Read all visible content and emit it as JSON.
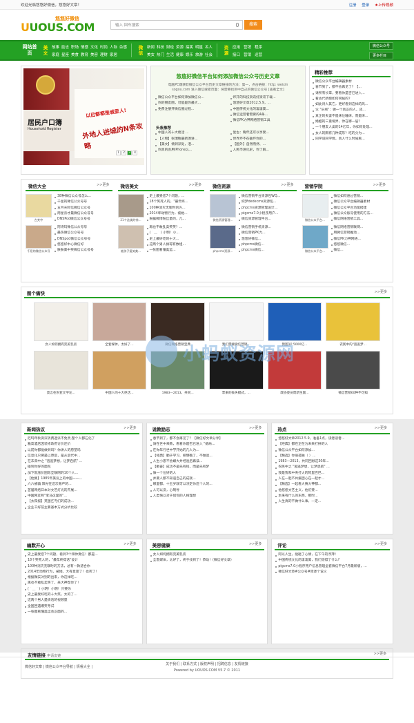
{
  "topbar": {
    "welcome": "欢迎光临悠悠好微信，悠悠好文章！",
    "login": "注册",
    "register": "登录",
    "fav": "★上传视频"
  },
  "logo": {
    "main_a": "U",
    "main_b": "UOUS.COM",
    "sub": "悠悠好微信"
  },
  "search": {
    "placeholder": "输入 回车搜索",
    "button": "搜索"
  },
  "nav": {
    "home": "网站首页",
    "g1_title": "美文",
    "g1_items": [
      "故事",
      "励志",
      "职场",
      "情感",
      "文化",
      "时尚",
      "人际",
      "杂感",
      "家庭",
      "星座",
      "美食",
      "教育",
      "美容",
      "理财",
      "家居"
    ],
    "g2_title": "微信",
    "g2_items": [
      "新闻",
      "科技",
      "财经",
      "资源",
      "搞笑",
      "明星",
      "名人",
      "美女",
      "热门",
      "生活",
      "健康",
      "娱乐",
      "旅游",
      "社会"
    ],
    "g3_title": "资源",
    "g3_items": [
      "应用",
      "营销",
      "程序",
      "接口",
      "营销",
      "运营"
    ],
    "btn1": "微信公众号",
    "btn2": "更多栏目"
  },
  "banner": {
    "book": "居民户口簿",
    "book_en": "Household Register",
    "tag1": "以后都都是城里人!",
    "tag2": "外地人进城的N条攻略",
    "pages": [
      "1",
      "2",
      "3",
      "4"
    ]
  },
  "headline": {
    "title": "悠悠好微信平台如何添加微信公众号历史文章",
    "summary": "电脑PC端获取微信公众平台历史文章链接的方法：第一，点击链接：http: weixin sogou.com 进入微信搜索页面：将需要找到中自己的微信公众号 [查看全文]",
    "left": [
      "微信公众平台如何添加微信公...",
      "你的朋友圈，可能是你最大...",
      "免费注册开微信圈过程..."
    ],
    "right": [
      "炸开的科技资讯好资讯下载...",
      "悠悠好文章2012.5.9，...",
      "中国传统文化的凄凄美...",
      "微信运营者需要的4条...",
      "微信PK力神网络营销工具"
    ],
    "sub": "头条推荐",
    "left2": [
      "中国人的十大绝活 ...",
      "【人物】张瑞敏最新演讲...",
      "【美文】情到深处，泪...",
      "你真的会用iPhone么..."
    ],
    "right2": [
      "复古：晚年还可以享受...",
      "世界坏不在破坏你的...",
      "【国外】自然而然、...",
      "人民币进化史，你了解..."
    ],
    "right3": [
      "陈儿发现自己就是...",
      "【解码】防范工商...",
      "幽默，看在外国人...",
      "一张图看懂16个..."
    ]
  },
  "recommend": {
    "title": "精彩推荐",
    "items": [
      "微信公众平台编辑器素材",
      "春节到了，都不会再见了？【...",
      "请所有长辈，要看你是否已进入...",
      "看古代新娘如何伺候的？",
      "如此诗人其它，更好看到这样的风...",
      "论 \"乐线\"：做一个真正的人，还...",
      "真正的夫妻不是床位睡床，而是床...",
      "婚姻的三重境界，你在哪一层？",
      "一个朋友人类的14亿年，你如何处理...",
      "女人的胸有几种成形？吃的分为...",
      "同学说同学情，真人什么时候看..."
    ]
  },
  "row2": [
    {
      "title": "微信大全",
      "more": ">>更多",
      "cap1": "古关中",
      "cap2": "千屈的微信公众号",
      "list1": [
        "38种微信公众号怎么...",
        "千屈的微信公众号号",
        "五月天阿信微信公众号",
        "周星云才最微信公众号号",
        "DNSPod微信公众号号"
      ],
      "list2": [
        "阿诗玛微信公众号号",
        "最热微信公众号号",
        "DNSpod微信公众号号",
        "悠悠好中心微信好",
        "肤肤美中奖微信公众号号"
      ]
    },
    {
      "title": "微信美文",
      "more": ">>更多",
      "cap1": "21个这类的惊...",
      "cap2": "被孩子爱笑美...",
      "list1": [
        "史上最受您7个问题，...",
        "18个笑死人的，\"最年终...",
        "100种消灭无聊时的方...",
        "2014年动物行为，被她...",
        "根据微博粉丝量的，几..."
      ],
      "list2": [
        "再也不敢乱卖笑笑？...",
        "(＾＿＾) 小明！小...",
        "史上最好吃的十大...",
        "这两个男人搞得有数组...",
        "一张图看懂奥运..."
      ]
    },
    {
      "title": "微信资源",
      "more": ">>更多",
      "cap1": "微信资源管理...",
      "cap2": "phpcms资源...",
      "list1": [
        "微信营销平台资源包WQ...",
        "织梦dedecms资源包...",
        "phpcms资源管理设计...",
        "pigcms7.0小程序用户...",
        "微信资源管理平台..."
      ],
      "list2": [
        "微信营销手机资源...",
        "微信营销PK力...",
        "悠悠好微信...",
        "phpcms微信...",
        "phpcms微信..."
      ]
    },
    {
      "title": "营销学院",
      "more": ">>更多",
      "cap1": "微信公众平台...",
      "cap2": "微信公众平台...",
      "list1": [
        "微信如何通过营销...",
        "微信公众平台编辑器素材",
        "微信公众平台功能搭建",
        "微信公众账号使用的方法...",
        "微信网络营销工具..."
      ],
      "list2": [
        "微信网络营销联网...",
        "用微信营销推动...",
        "微信PK力神网络...",
        "悠悠微信...",
        "微信..."
      ]
    }
  ],
  "gallery": {
    "title": "图个痛快",
    "more": ">>更多",
    "items": [
      "女人如何拥有完美乳房",
      "全套媒体，太好了...",
      "微信网络营销宝典",
      "我们需要微信营销...",
      "我国1P 5000亿...",
      "农民中的\"逃逃梦...",
      "莫言在东亚文学论...",
      "中国人的十大绝活...",
      "1983—2013，共同...",
      "苹果的丢失模式，...",
      "政协委员周新生震...",
      "微信营销60种不可知"
    ]
  },
  "news": {
    "title": "新闻热议",
    "more": ">>更多",
    "items": [
      "厄玛年秋资深消费选派不免责,整个人都石化了",
      "雅高酒店因装修政府讨价还价",
      "以前你都能做到吗？你讲人的愿望吗",
      "信息化只要是以原后，是从后代中...",
      "在未来中之 \"逃逃梦想，让梦启航\" ...",
      "碰到你好的面包",
      "加下就涨价国际互联网的10个人...",
      "【他集】1985年美议上的中国——...",
      "六六被骗 阳光在这次尊严的...",
      "首届网络日本对文艺灯光的开展...",
      "中国网友称\"宝马这里的\"...",
      "【太阳报】英国乞丐们的成功...",
      "企业干好前主要基本方式分析比较"
    ]
  },
  "inspire": {
    "title": "说教励志",
    "more": ">>更多",
    "items": [
      "春节到了，都不会再见了？【微信好文章分享】",
      "请在世中来教，看看你是否已进入 \"婚局...",
      "在你年行世中学开始的几人为...",
      "【经典】勤于学习、把明确了，不做迷...",
      "人生小思不会嫌大并经验后再读...",
      "【勤奋】成功不是先有钱，而是先有梦",
      "做一个位好的人",
      "并要人都不知道自己的成就...",
      "哪里都，十五岁就可以决定你这个人的...",
      "人可以没，心制导",
      "人类悟以对于如何的人格理想"
    ]
  },
  "hot": {
    "title": "热点",
    "more": ">>更多",
    "items": [
      "悠悠好文章2012.5.9，准备1点，读者读者...",
      "【经典】都在正在为未来打拼的人",
      "微信公众平台如何添加...",
      "【精选】你很孤独（ ）...",
      "1983—2013，共同回顾这30年...",
      "农民中之 \"逃逃梦想，让梦启航\" ...",
      "我是我和中央打火的阿里巴巴...",
      "人在一起不共振因心在一起才...",
      "【精选】一起看大赛大神都...",
      "他悠悠文艺主义，他们要...",
      "本来有什么的东西，那时...",
      "人生真的不做什么事，一定..."
    ]
  },
  "humor": {
    "title": "幽默开心",
    "more": ">>更多",
    "items": [
      "史上最受您7个问题，看到3个拜你受信！都是...",
      "18个笑死人的，\"最年终得话\"设计",
      "100种消灭无聊时的方法，总有一款适合你",
      "2014年动物行为，被她，大有意思了！也死了！",
      "根据微实对别的出来，你这样吃...",
      "再也不敢乱卖笑了，来大神帮你了！",
      "(＾＿＾) 小明！小明！只要你",
      "史上最受好吃的十大笑，太的了...",
      "这两个男人是情话的视频量",
      "全国回遇爆笑考试",
      "一张图看懂奥运会正面的..."
    ]
  },
  "beauty": {
    "title": "美容健康",
    "more": ">>更多",
    "items": [
      "女人如何拥有完美乳房",
      "全套媒体，太好了，终于找到了！恭动！(微信好文章)"
    ]
  },
  "comment": {
    "title": "评论",
    "more": ">>更多",
    "items": [
      "阿以人生，能碰了心情，在下午的浮萍！",
      "中国传统文化的凄凄美，我们觉得了什么?",
      "pigcms7.0小程序用户信息管理全套微信平台7月最新版，...",
      "微信好文章#公众号#简述个说义"
    ]
  },
  "links": {
    "title": "友情链接",
    "apply": "申请友链",
    "more": ">>更多",
    "items": "微信好文章 | 微信公众平台导航 | 情睿大全 |"
  },
  "footer": {
    "line1": "关于我们 | 联系方式 | 版权声明 | 招聘信息 | 友情链接",
    "line2": "Powered by UOUOS.COM V5.7 © 2011"
  },
  "watermark": "小蚂蚁资源网"
}
